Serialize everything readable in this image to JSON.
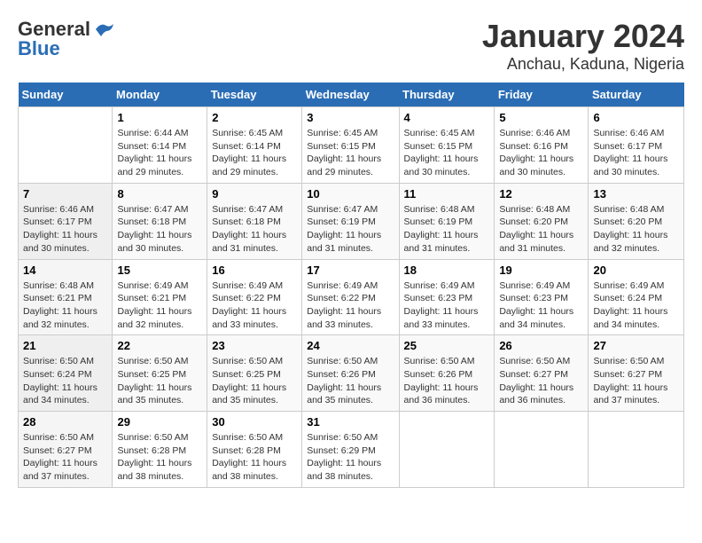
{
  "header": {
    "logo_line1": "General",
    "logo_line2": "Blue",
    "title": "January 2024",
    "subtitle": "Anchau, Kaduna, Nigeria"
  },
  "weekdays": [
    "Sunday",
    "Monday",
    "Tuesday",
    "Wednesday",
    "Thursday",
    "Friday",
    "Saturday"
  ],
  "weeks": [
    [
      {
        "num": "",
        "detail": ""
      },
      {
        "num": "1",
        "detail": "Sunrise: 6:44 AM\nSunset: 6:14 PM\nDaylight: 11 hours\nand 29 minutes."
      },
      {
        "num": "2",
        "detail": "Sunrise: 6:45 AM\nSunset: 6:14 PM\nDaylight: 11 hours\nand 29 minutes."
      },
      {
        "num": "3",
        "detail": "Sunrise: 6:45 AM\nSunset: 6:15 PM\nDaylight: 11 hours\nand 29 minutes."
      },
      {
        "num": "4",
        "detail": "Sunrise: 6:45 AM\nSunset: 6:15 PM\nDaylight: 11 hours\nand 30 minutes."
      },
      {
        "num": "5",
        "detail": "Sunrise: 6:46 AM\nSunset: 6:16 PM\nDaylight: 11 hours\nand 30 minutes."
      },
      {
        "num": "6",
        "detail": "Sunrise: 6:46 AM\nSunset: 6:17 PM\nDaylight: 11 hours\nand 30 minutes."
      }
    ],
    [
      {
        "num": "7",
        "detail": "Sunrise: 6:46 AM\nSunset: 6:17 PM\nDaylight: 11 hours\nand 30 minutes."
      },
      {
        "num": "8",
        "detail": "Sunrise: 6:47 AM\nSunset: 6:18 PM\nDaylight: 11 hours\nand 30 minutes."
      },
      {
        "num": "9",
        "detail": "Sunrise: 6:47 AM\nSunset: 6:18 PM\nDaylight: 11 hours\nand 31 minutes."
      },
      {
        "num": "10",
        "detail": "Sunrise: 6:47 AM\nSunset: 6:19 PM\nDaylight: 11 hours\nand 31 minutes."
      },
      {
        "num": "11",
        "detail": "Sunrise: 6:48 AM\nSunset: 6:19 PM\nDaylight: 11 hours\nand 31 minutes."
      },
      {
        "num": "12",
        "detail": "Sunrise: 6:48 AM\nSunset: 6:20 PM\nDaylight: 11 hours\nand 31 minutes."
      },
      {
        "num": "13",
        "detail": "Sunrise: 6:48 AM\nSunset: 6:20 PM\nDaylight: 11 hours\nand 32 minutes."
      }
    ],
    [
      {
        "num": "14",
        "detail": "Sunrise: 6:48 AM\nSunset: 6:21 PM\nDaylight: 11 hours\nand 32 minutes."
      },
      {
        "num": "15",
        "detail": "Sunrise: 6:49 AM\nSunset: 6:21 PM\nDaylight: 11 hours\nand 32 minutes."
      },
      {
        "num": "16",
        "detail": "Sunrise: 6:49 AM\nSunset: 6:22 PM\nDaylight: 11 hours\nand 33 minutes."
      },
      {
        "num": "17",
        "detail": "Sunrise: 6:49 AM\nSunset: 6:22 PM\nDaylight: 11 hours\nand 33 minutes."
      },
      {
        "num": "18",
        "detail": "Sunrise: 6:49 AM\nSunset: 6:23 PM\nDaylight: 11 hours\nand 33 minutes."
      },
      {
        "num": "19",
        "detail": "Sunrise: 6:49 AM\nSunset: 6:23 PM\nDaylight: 11 hours\nand 34 minutes."
      },
      {
        "num": "20",
        "detail": "Sunrise: 6:49 AM\nSunset: 6:24 PM\nDaylight: 11 hours\nand 34 minutes."
      }
    ],
    [
      {
        "num": "21",
        "detail": "Sunrise: 6:50 AM\nSunset: 6:24 PM\nDaylight: 11 hours\nand 34 minutes."
      },
      {
        "num": "22",
        "detail": "Sunrise: 6:50 AM\nSunset: 6:25 PM\nDaylight: 11 hours\nand 35 minutes."
      },
      {
        "num": "23",
        "detail": "Sunrise: 6:50 AM\nSunset: 6:25 PM\nDaylight: 11 hours\nand 35 minutes."
      },
      {
        "num": "24",
        "detail": "Sunrise: 6:50 AM\nSunset: 6:26 PM\nDaylight: 11 hours\nand 35 minutes."
      },
      {
        "num": "25",
        "detail": "Sunrise: 6:50 AM\nSunset: 6:26 PM\nDaylight: 11 hours\nand 36 minutes."
      },
      {
        "num": "26",
        "detail": "Sunrise: 6:50 AM\nSunset: 6:27 PM\nDaylight: 11 hours\nand 36 minutes."
      },
      {
        "num": "27",
        "detail": "Sunrise: 6:50 AM\nSunset: 6:27 PM\nDaylight: 11 hours\nand 37 minutes."
      }
    ],
    [
      {
        "num": "28",
        "detail": "Sunrise: 6:50 AM\nSunset: 6:27 PM\nDaylight: 11 hours\nand 37 minutes."
      },
      {
        "num": "29",
        "detail": "Sunrise: 6:50 AM\nSunset: 6:28 PM\nDaylight: 11 hours\nand 38 minutes."
      },
      {
        "num": "30",
        "detail": "Sunrise: 6:50 AM\nSunset: 6:28 PM\nDaylight: 11 hours\nand 38 minutes."
      },
      {
        "num": "31",
        "detail": "Sunrise: 6:50 AM\nSunset: 6:29 PM\nDaylight: 11 hours\nand 38 minutes."
      },
      {
        "num": "",
        "detail": ""
      },
      {
        "num": "",
        "detail": ""
      },
      {
        "num": "",
        "detail": ""
      }
    ]
  ]
}
